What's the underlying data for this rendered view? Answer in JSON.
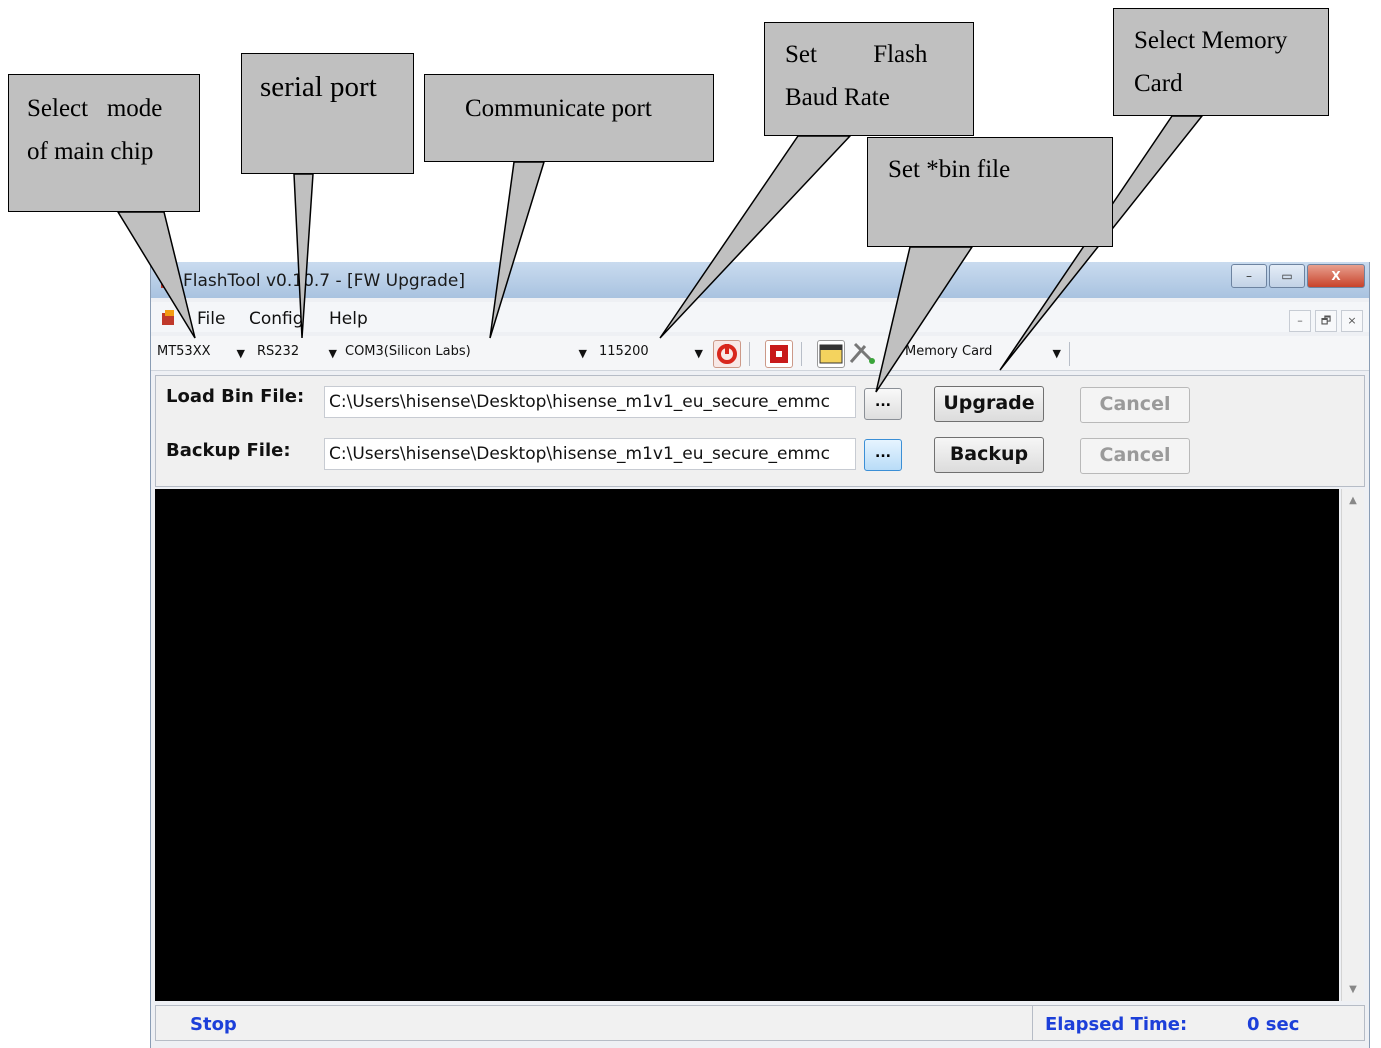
{
  "window": {
    "title": "FlashTool v0.10.7 - [FW Upgrade]",
    "controls": {
      "minimize": "–",
      "maximize": "▭",
      "close": "X"
    }
  },
  "menu": {
    "items": [
      "File",
      "Config",
      "Help"
    ],
    "mdi_controls": [
      "–",
      "🗗",
      "×"
    ]
  },
  "toolbar": {
    "chip_mode": "MT53XX",
    "serial_port": "RS232",
    "com_port": "COM3(Silicon Labs)",
    "baud_rate": "115200",
    "memory_card": "Memory Card",
    "icons": [
      "connect-icon",
      "stop-icon",
      "settings-icon",
      "tools-icon"
    ],
    "colors": {
      "connect": "#d8261c",
      "stop": "#c81a1a"
    }
  },
  "panel": {
    "load_label": "Load Bin File:",
    "load_path": "C:\\Users\\hisense\\Desktop\\hisense_m1v1_eu_secure_emmc",
    "backup_label": "Backup File:",
    "backup_path": "C:\\Users\\hisense\\Desktop\\hisense_m1v1_eu_secure_emmc",
    "browse_label": "...",
    "upgrade_label": "Upgrade",
    "backup_button_label": "Backup",
    "cancel_label": "Cancel"
  },
  "status": {
    "state": "Stop",
    "elapsed_label": "Elapsed Time:",
    "elapsed_value": "0 sec",
    "color": "#1c3fd9"
  },
  "annotations": {
    "select_mode": [
      "Select   mode",
      "of main chip"
    ],
    "serial_port": "serial port",
    "communicate_port": "Communicate port",
    "flash_baud": [
      "Set         Flash",
      "Baud Rate"
    ],
    "bin_file": "Set *bin file",
    "memory_card": [
      "Select Memory",
      "Card"
    ]
  }
}
